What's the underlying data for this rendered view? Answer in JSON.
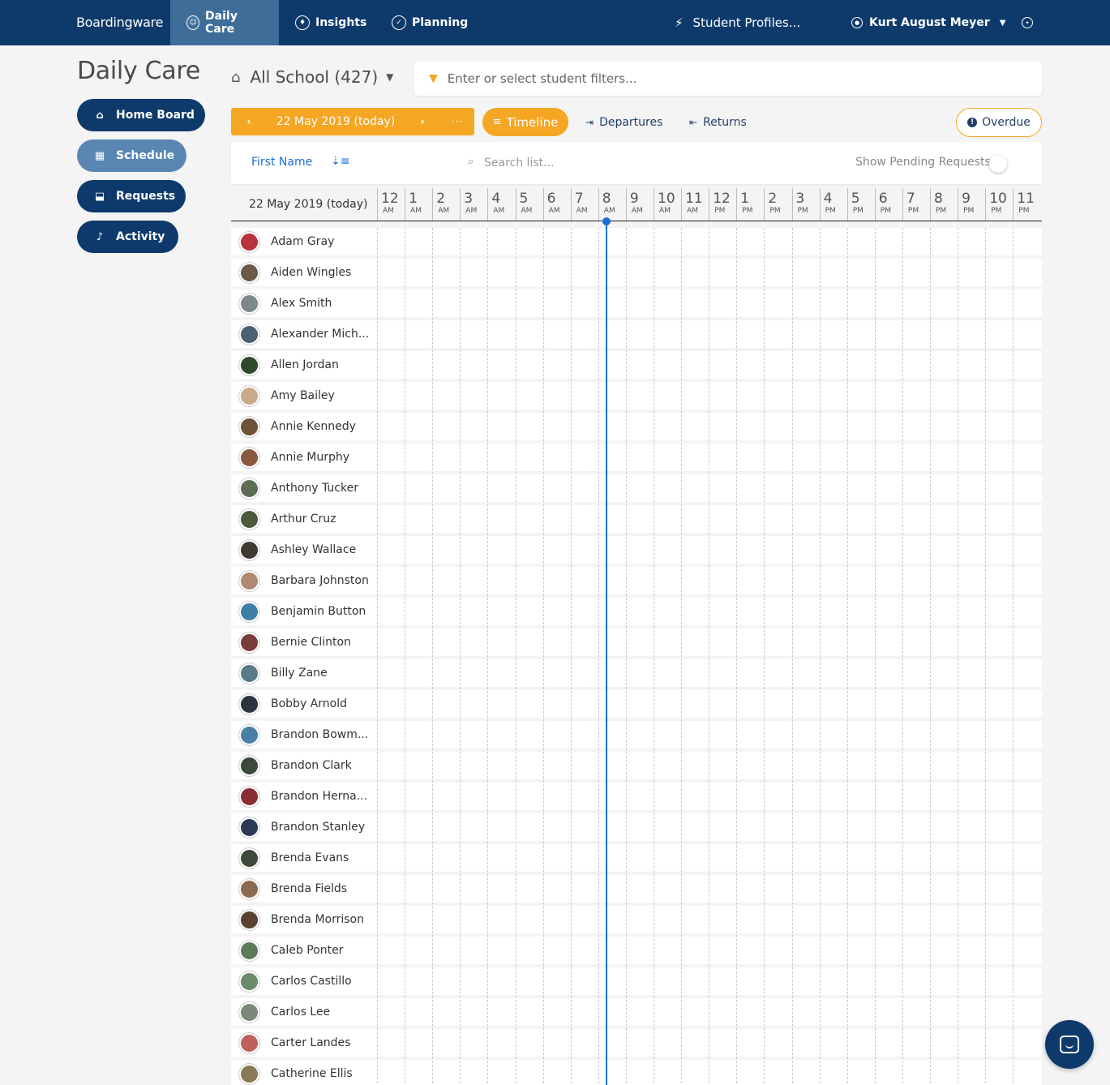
{
  "topnav": {
    "brand": "Boardingware",
    "tabs": [
      {
        "label": "Daily Care",
        "icon": "person-icon",
        "glyph": "☺"
      },
      {
        "label": "Insights",
        "icon": "lightbulb-icon",
        "glyph": "♦"
      },
      {
        "label": "Planning",
        "icon": "calendar-icon",
        "glyph": "✓"
      }
    ],
    "quick_search": "Student Profiles...",
    "user_name": "Kurt August Meyer"
  },
  "sidebar": {
    "title": "Daily Care",
    "items": [
      {
        "label": "Home Board",
        "icon": "home-icon",
        "glyph": "⌂"
      },
      {
        "label": "Schedule",
        "icon": "calendar-icon",
        "glyph": "▦"
      },
      {
        "label": "Requests",
        "icon": "inbox-icon",
        "glyph": "⬓"
      },
      {
        "label": "Activity",
        "icon": "bell-icon",
        "glyph": "♪"
      }
    ]
  },
  "header": {
    "scope": "All School (427)",
    "filter_placeholder": "Enter or select student filters..."
  },
  "toolbar": {
    "date_label": "22 May 2019 (today)",
    "prev": "‹",
    "next": "›",
    "more": "···",
    "timeline_label": "Timeline",
    "departures_label": "Departures",
    "returns_label": "Returns",
    "overdue_label": "Overdue"
  },
  "list": {
    "sort_label": "First Name",
    "search_placeholder": "Search list...",
    "pending_label": "Show Pending Requests"
  },
  "timeline": {
    "date_label": "22 May 2019 (today)",
    "hours": [
      {
        "h": "12",
        "ap": "AM"
      },
      {
        "h": "1",
        "ap": "AM"
      },
      {
        "h": "2",
        "ap": "AM"
      },
      {
        "h": "3",
        "ap": "AM"
      },
      {
        "h": "4",
        "ap": "AM"
      },
      {
        "h": "5",
        "ap": "AM"
      },
      {
        "h": "6",
        "ap": "AM"
      },
      {
        "h": "7",
        "ap": "AM"
      },
      {
        "h": "8",
        "ap": "AM"
      },
      {
        "h": "9",
        "ap": "AM"
      },
      {
        "h": "10",
        "ap": "AM"
      },
      {
        "h": "11",
        "ap": "AM"
      },
      {
        "h": "12",
        "ap": "PM"
      },
      {
        "h": "1",
        "ap": "PM"
      },
      {
        "h": "2",
        "ap": "PM"
      },
      {
        "h": "3",
        "ap": "PM"
      },
      {
        "h": "4",
        "ap": "PM"
      },
      {
        "h": "5",
        "ap": "PM"
      },
      {
        "h": "6",
        "ap": "PM"
      },
      {
        "h": "7",
        "ap": "PM"
      },
      {
        "h": "8",
        "ap": "PM"
      },
      {
        "h": "9",
        "ap": "PM"
      },
      {
        "h": "10",
        "ap": "PM"
      },
      {
        "h": "11",
        "ap": "PM"
      }
    ],
    "current_hour": 8.3,
    "students": [
      {
        "name": "Adam Gray",
        "color": "#b8323a"
      },
      {
        "name": "Aiden Wingles",
        "color": "#6b5a48"
      },
      {
        "name": "Alex Smith",
        "color": "#7a8a8c"
      },
      {
        "name": "Alexander Mich...",
        "color": "#4d5f73"
      },
      {
        "name": "Allen Jordan",
        "color": "#2e4a2a"
      },
      {
        "name": "Amy Bailey",
        "color": "#c9a98a"
      },
      {
        "name": "Annie Kennedy",
        "color": "#6e5238"
      },
      {
        "name": "Annie Murphy",
        "color": "#8a5a3f"
      },
      {
        "name": "Anthony Tucker",
        "color": "#5c6e55"
      },
      {
        "name": "Arthur Cruz",
        "color": "#4a5a3a"
      },
      {
        "name": "Ashley Wallace",
        "color": "#3f3a30"
      },
      {
        "name": "Barbara Johnston",
        "color": "#b08a70"
      },
      {
        "name": "Benjamin Button",
        "color": "#3d7fa6"
      },
      {
        "name": "Bernie Clinton",
        "color": "#7a3d3a"
      },
      {
        "name": "Billy Zane",
        "color": "#5a7a8a"
      },
      {
        "name": "Bobby Arnold",
        "color": "#2a3540"
      },
      {
        "name": "Brandon Bowm...",
        "color": "#4a7fa6"
      },
      {
        "name": "Brandon Clark",
        "color": "#3a4a3a"
      },
      {
        "name": "Brandon Herna...",
        "color": "#8a2e35"
      },
      {
        "name": "Brandon Stanley",
        "color": "#2a3a55"
      },
      {
        "name": "Brenda Evans",
        "color": "#3d4a38"
      },
      {
        "name": "Brenda Fields",
        "color": "#8a6a50"
      },
      {
        "name": "Brenda Morrison",
        "color": "#5a4030"
      },
      {
        "name": "Caleb Ponter",
        "color": "#5a7a5a"
      },
      {
        "name": "Carlos Castillo",
        "color": "#6a8a6a"
      },
      {
        "name": "Carlos Lee",
        "color": "#7a8a7a"
      },
      {
        "name": "Carter Landes",
        "color": "#c0605a"
      },
      {
        "name": "Catherine Ellis",
        "color": "#8a7a55"
      }
    ]
  }
}
